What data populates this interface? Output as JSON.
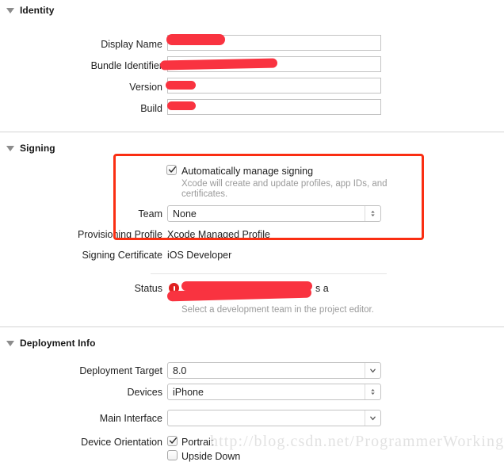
{
  "sections": [
    {
      "title": "Identity"
    },
    {
      "title": "Signing"
    },
    {
      "title": "Deployment Info"
    }
  ],
  "identity": {
    "fields": [
      {
        "label": "Display Name",
        "value": ""
      },
      {
        "label": "Bundle Identifier",
        "value": ""
      },
      {
        "label": "Version",
        "value": ""
      },
      {
        "label": "Build",
        "value": ""
      }
    ]
  },
  "signing": {
    "auto_manage_label": "Automatically manage signing",
    "auto_manage_checked": true,
    "auto_manage_hint_line1": "Xcode will create and update profiles, app IDs, and",
    "auto_manage_hint_line2": "certificates.",
    "team_label": "Team",
    "team_value": "None",
    "provisioning_profile_label": "Provisioning Profile",
    "provisioning_profile_value": "Xcode Managed Profile",
    "signing_certificate_label": "Signing Certificate",
    "signing_certificate_value": "iOS Developer",
    "status_label": "Status",
    "status_hint": "Select a development team in the project editor.",
    "status_tail_1": "s a",
    "status_tail_2": ""
  },
  "deployment": {
    "deployment_target_label": "Deployment Target",
    "deployment_target_value": "8.0",
    "devices_label": "Devices",
    "devices_value": "iPhone",
    "main_interface_label": "Main Interface",
    "main_interface_value": "",
    "device_orientation_label": "Device Orientation",
    "orientations": [
      {
        "label": "Portrait",
        "checked": true
      },
      {
        "label": "Upside Down",
        "checked": false
      }
    ]
  },
  "watermark": {
    "text": "http://blog.csdn.net/ProgrammerWorking"
  },
  "colors": {
    "redaction": "#f93340",
    "highlight_box": "#fa2e12",
    "error_badge": "#e02020",
    "divider": "#d4d4d4"
  }
}
